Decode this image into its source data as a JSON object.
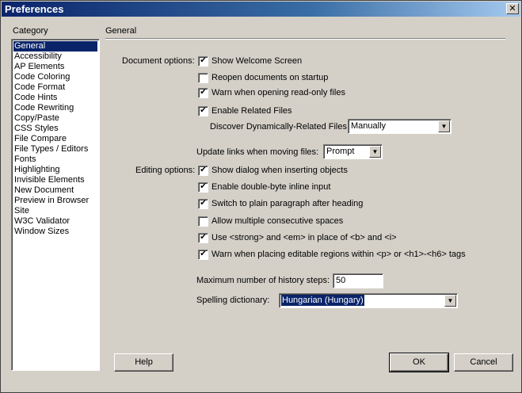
{
  "window": {
    "title": "Preferences",
    "close_glyph": "✕"
  },
  "category": {
    "heading": "Category",
    "items": [
      "General",
      "Accessibility",
      "AP Elements",
      "Code Coloring",
      "Code Format",
      "Code Hints",
      "Code Rewriting",
      "Copy/Paste",
      "CSS Styles",
      "File Compare",
      "File Types / Editors",
      "Fonts",
      "Highlighting",
      "Invisible Elements",
      "New Document",
      "Preview in Browser",
      "Site",
      "W3C Validator",
      "Window Sizes"
    ],
    "selected": "General"
  },
  "panel": {
    "title": "General",
    "document_options_label": "Document options:",
    "editing_options_label": "Editing options:",
    "show_welcome": {
      "label": "Show Welcome Screen",
      "checked": true
    },
    "reopen_docs": {
      "label": "Reopen documents on startup",
      "checked": false
    },
    "warn_readonly": {
      "label": "Warn when opening read-only files",
      "checked": true
    },
    "enable_related": {
      "label": "Enable Related Files",
      "checked": true
    },
    "discover_label": "Discover Dynamically-Related Files:",
    "discover_value": "Manually",
    "update_links_label": "Update links when moving files:",
    "update_links_value": "Prompt",
    "show_dialog": {
      "label": "Show dialog when inserting objects",
      "checked": true
    },
    "double_byte": {
      "label": "Enable double-byte inline input",
      "checked": true
    },
    "plain_paragraph": {
      "label": "Switch to plain paragraph after heading",
      "checked": true
    },
    "multiple_spaces": {
      "label": "Allow multiple consecutive spaces",
      "checked": false
    },
    "strong_em": {
      "label": "Use <strong> and <em> in place of <b> and <i>",
      "checked": true
    },
    "warn_editable": {
      "label": "Warn when placing editable regions within <p> or <h1>-<h6> tags",
      "checked": true
    },
    "history_label": "Maximum number of history steps:",
    "history_value": "50",
    "spelling_label": "Spelling dictionary:",
    "spelling_value": "Hungarian (Hungary)"
  },
  "buttons": {
    "help": "Help",
    "ok": "OK",
    "cancel": "Cancel"
  },
  "icons": {
    "check": "✔",
    "dropdown": "▼"
  },
  "colors": {
    "selection": "#0a246a",
    "face": "#d4d0c8"
  }
}
